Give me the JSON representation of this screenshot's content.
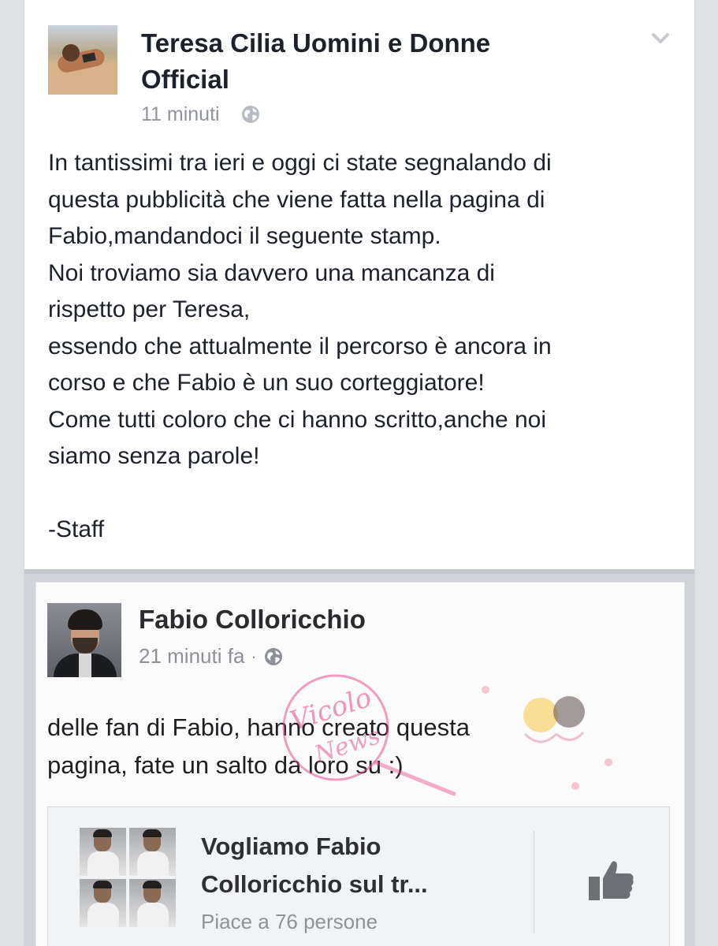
{
  "post": {
    "page_name_line1": "Teresa Cilia Uomini e Donne",
    "page_name_line2": "Official",
    "time": "11 minuti",
    "body_lines": [
      "In tantissimi tra ieri e oggi ci state segnalando di",
      "questa pubblicità che viene fatta nella pagina di",
      "Fabio,mandandoci il seguente stamp.",
      "Noi troviamo sia davvero una mancanza di",
      "rispetto per Teresa,",
      "essendo che attualmente il percorso è ancora in",
      "corso e che Fabio è un suo corteggiatore!",
      "Come tutti coloro che ci hanno scritto,anche noi",
      "siamo senza parole!"
    ],
    "signature": "-Staff"
  },
  "shared_screenshot": {
    "author": "Fabio Colloricchio",
    "time": "21 minuti fa",
    "separator": "·",
    "text_lines": [
      "delle fan di Fabio, hanno creato questa",
      "pagina, fate un salto da loro su :)"
    ],
    "page_card": {
      "title_line1": "Vogliamo Fabio",
      "title_line2": "Colloricchio sul tr...",
      "likes": "Piace a 76 persone"
    },
    "watermark_text": "Vicolo News"
  },
  "colors": {
    "name_text": "#1d2129",
    "meta_text": "#90949c",
    "watermark_pink": "#e6508f"
  },
  "icons": [
    "chevron-down-icon",
    "globe-icon",
    "like-icon"
  ]
}
